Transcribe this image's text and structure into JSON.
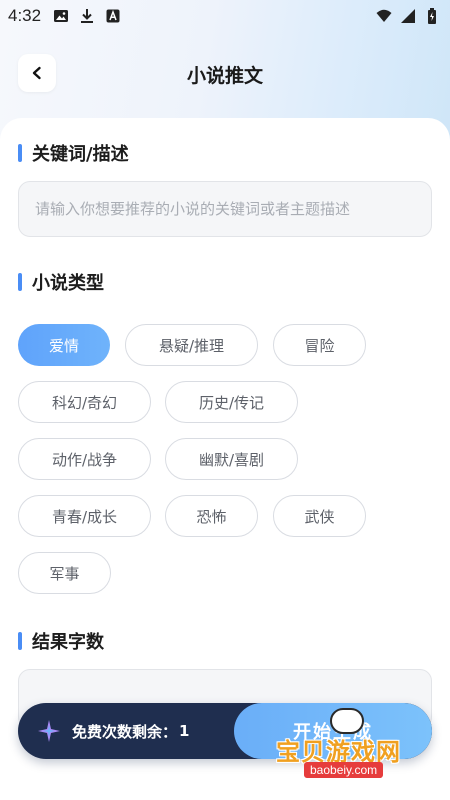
{
  "status_bar": {
    "time": "4:32",
    "left_icons": [
      "image-icon",
      "download-icon",
      "a-box-icon"
    ],
    "right_icons": [
      "wifi-icon",
      "signal-icon",
      "battery-icon"
    ]
  },
  "header": {
    "title": "小说推文",
    "back_icon": "chevron-left-icon"
  },
  "keyword_section": {
    "title": "关键词/描述",
    "placeholder": "请输入你想要推荐的小说的关键词或者主题描述",
    "value": ""
  },
  "genre_section": {
    "title": "小说类型",
    "tags": [
      {
        "label": "爱情",
        "selected": true
      },
      {
        "label": "悬疑/推理",
        "selected": false
      },
      {
        "label": "冒险",
        "selected": false
      },
      {
        "label": "科幻/奇幻",
        "selected": false
      },
      {
        "label": "历史/传记",
        "selected": false
      },
      {
        "label": "动作/战争",
        "selected": false
      },
      {
        "label": "幽默/喜剧",
        "selected": false
      },
      {
        "label": "青春/成长",
        "selected": false
      },
      {
        "label": "恐怖",
        "selected": false
      },
      {
        "label": "武侠",
        "selected": false
      },
      {
        "label": "军事",
        "selected": false
      }
    ]
  },
  "wordcount_section": {
    "title": "结果字数"
  },
  "bottom_bar": {
    "free_label": "免费次数剩余：",
    "free_count": "1",
    "start_label": "开始生成"
  },
  "watermark": {
    "text": "宝贝游戏网",
    "url": "baobeiy.com"
  },
  "colors": {
    "accent": "#5fa3fb",
    "dark_bar": "#1f2e4f",
    "section_bar": "#4a8df5"
  }
}
